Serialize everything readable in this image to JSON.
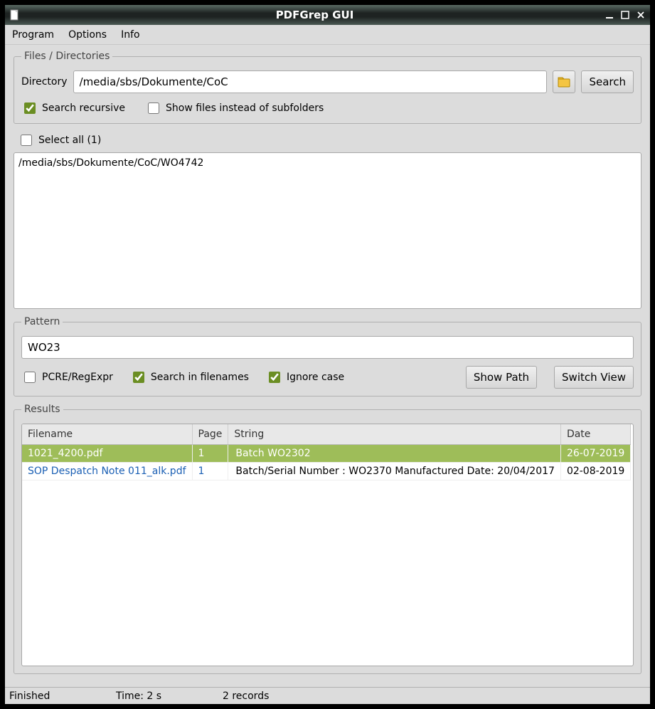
{
  "window": {
    "title": "PDFGrep GUI"
  },
  "menu": {
    "program": "Program",
    "options": "Options",
    "info": "Info"
  },
  "files_group": {
    "legend": "Files / Directories",
    "dir_label": "Directory",
    "dir_value": "/media/sbs/Dokumente/CoC",
    "search_btn": "Search",
    "recursive_label": "Search recursive",
    "recursive_checked": true,
    "showfiles_label": "Show files instead of subfolders",
    "showfiles_checked": false
  },
  "select_all": {
    "label": "Select all (1)",
    "checked": false
  },
  "list_items": [
    "/media/sbs/Dokumente/CoC/WO4742"
  ],
  "pattern_group": {
    "legend": "Pattern",
    "value": "WO23",
    "pcre_label": "PCRE/RegExpr",
    "pcre_checked": false,
    "fname_label": "Search in filenames",
    "fname_checked": true,
    "icase_label": "Ignore case",
    "icase_checked": true,
    "show_path_btn": "Show Path",
    "switch_view_btn": "Switch View"
  },
  "results_group": {
    "legend": "Results",
    "columns": {
      "filename": "Filename",
      "page": "Page",
      "string": "String",
      "date": "Date"
    },
    "rows": [
      {
        "filename": "1021_4200.pdf",
        "page": "1",
        "string": "Batch WO2302",
        "date": "26-07-2019",
        "selected": true
      },
      {
        "filename": "SOP Despatch Note 011_alk.pdf",
        "page": "1",
        "string": "Batch/Serial Number : WO2370 Manufactured Date: 20/04/2017",
        "date": "02-08-2019",
        "selected": false
      }
    ]
  },
  "statusbar": {
    "status": "Finished",
    "time": "Time: 2 s",
    "records": "2  records"
  }
}
